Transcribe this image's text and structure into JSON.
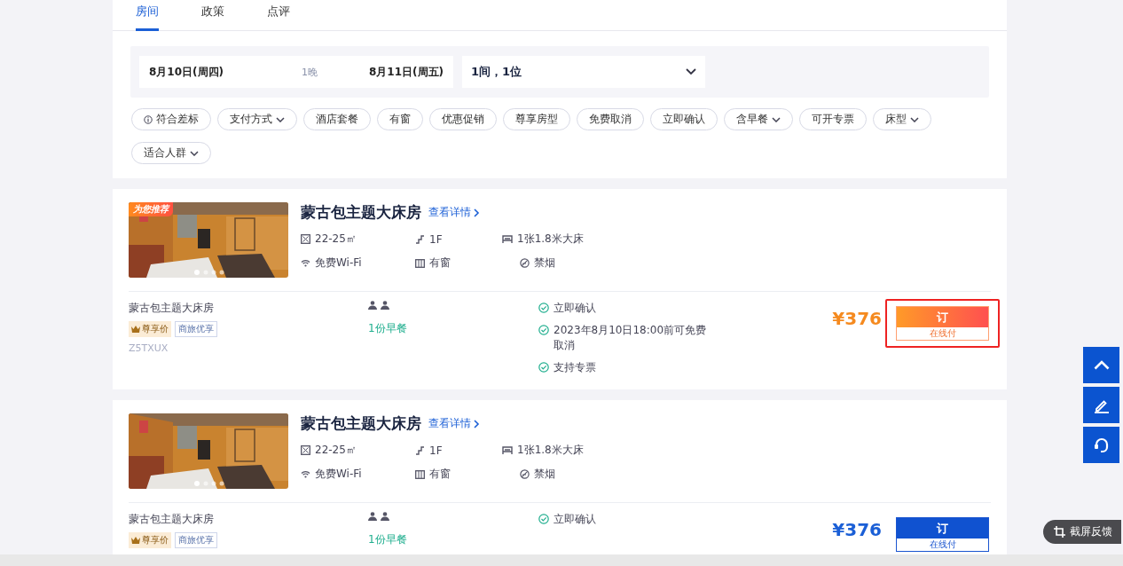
{
  "tabs": [
    {
      "label": "房间",
      "selected": true
    },
    {
      "label": "政策",
      "selected": false
    },
    {
      "label": "点评",
      "selected": false
    }
  ],
  "search": {
    "checkin": "8月10日(周四)",
    "nights": "1晚",
    "checkout": "8月11日(周五)",
    "guests": "1间，1位"
  },
  "filters": [
    {
      "label": "符合差标",
      "kind": "info"
    },
    {
      "label": "支付方式",
      "kind": "dropdown"
    },
    {
      "label": "酒店套餐",
      "kind": "plain"
    },
    {
      "label": "有窗",
      "kind": "plain"
    },
    {
      "label": "优惠促销",
      "kind": "plain"
    },
    {
      "label": "尊享房型",
      "kind": "plain"
    },
    {
      "label": "免费取消",
      "kind": "plain"
    },
    {
      "label": "立即确认",
      "kind": "plain"
    },
    {
      "label": "含早餐",
      "kind": "dropdown"
    },
    {
      "label": "可开专票",
      "kind": "plain"
    },
    {
      "label": "床型",
      "kind": "dropdown"
    },
    {
      "label": "适合人群",
      "kind": "dropdown"
    }
  ],
  "rooms": [
    {
      "badge": "为您推荐",
      "name": "蒙古包主题大床房",
      "details_link": "查看详情",
      "area": "22-25㎡",
      "floor": "1F",
      "bed": "1张1.8米大床",
      "wifi": "免费Wi-Fi",
      "window": "有窗",
      "smoking": "禁烟",
      "offer": {
        "name": "蒙古包主题大床房",
        "tags": [
          {
            "label": "尊享价",
            "kind": "premium"
          },
          {
            "label": "商旅优享",
            "kind": "business"
          }
        ],
        "code": "Z5TXUX",
        "breakfast": "1份早餐",
        "policies": [
          "立即确认",
          "2023年8月10日18:00前可免费取消",
          "支持专票"
        ],
        "price": "¥376",
        "book": "订",
        "pay": "在线付",
        "selected": true
      }
    },
    {
      "name": "蒙古包主题大床房",
      "details_link": "查看详情",
      "area": "22-25㎡",
      "floor": "1F",
      "bed": "1张1.8米大床",
      "wifi": "免费Wi-Fi",
      "window": "有窗",
      "smoking": "禁烟",
      "offer": {
        "name": "蒙古包主题大床房",
        "tags": [
          {
            "label": "尊享价",
            "kind": "premium"
          },
          {
            "label": "商旅优享",
            "kind": "business"
          }
        ],
        "breakfast": "1份早餐",
        "policies": [
          "立即确认"
        ],
        "price": "¥376",
        "book": "订",
        "pay": "在线付",
        "selected": false
      }
    }
  ],
  "feedback": "截屏反馈"
}
